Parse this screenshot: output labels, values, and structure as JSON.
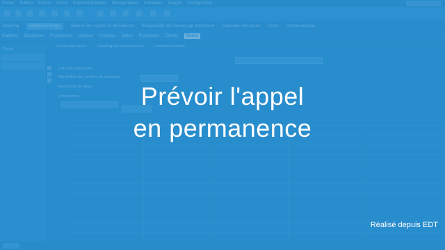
{
  "app": {
    "menu_items": [
      "Fichier",
      "Édition",
      "Emploi",
      "Calcul",
      "Imprimer/Exporter",
      "Récupérations",
      "Extraction",
      "Usages",
      "Configuration"
    ],
    "tabs_row1": [
      "Planning",
      "Emploi du temps",
      "Gestion des reports et annulations",
      "Récapitulatif des heures par professeur",
      "Calendrier des cours",
      "Cours",
      "Communication"
    ],
    "tabs_row1_active_index": 1,
    "tabs_row2": [
      "Matières",
      "Disciplines",
      "Professeurs",
      "Classes",
      "Groupes",
      "Salles",
      "Personnels",
      "Élèves",
      "Cours"
    ],
    "tabs_row2_active_index": 8,
    "left_panel_title": "Cours",
    "main_tabs": [
      "Gestion des cours",
      "Planning des permanences",
      "Cadences/cumuls"
    ],
    "form_labels": [
      "Liste des présences",
      "Répartition par nombre de semaines",
      "Recherche de filtres",
      "Prévisionnel"
    ]
  },
  "overlay": {
    "title_line1": "Prévoir l'appel",
    "title_line2": "en permanence",
    "credit": "Réalisé depuis EDT"
  }
}
